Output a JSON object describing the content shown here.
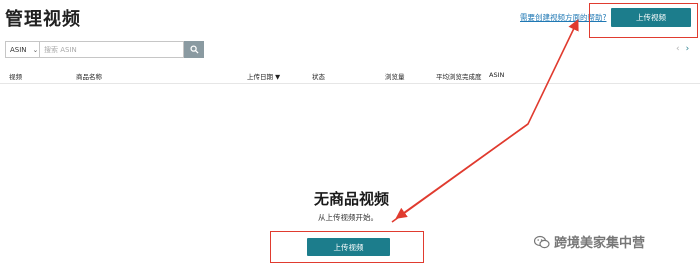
{
  "header": {
    "title": "管理视频",
    "help_link": "需要创建视频方面的帮助?",
    "upload_button": "上传视频"
  },
  "search": {
    "select_value": "ASIN",
    "placeholder": "搜索 ASIN"
  },
  "pagination": {
    "prev": "‹",
    "next": "›"
  },
  "table": {
    "columns": {
      "video": "视频",
      "product_name": "商品名称",
      "upload_date": "上传日期 ▼",
      "status": "状态",
      "views": "浏览量",
      "avg_completion": "平均浏览完成度",
      "asin": "ASIN"
    }
  },
  "empty_state": {
    "title": "无商品视频",
    "subtitle": "从上传视频开始。",
    "upload_button": "上传视频"
  },
  "watermark": {
    "text": "跨境美家集中营"
  },
  "colors": {
    "accent": "#1c7d8c",
    "annotation_red": "#e03b2f",
    "link": "#1f78b4"
  }
}
